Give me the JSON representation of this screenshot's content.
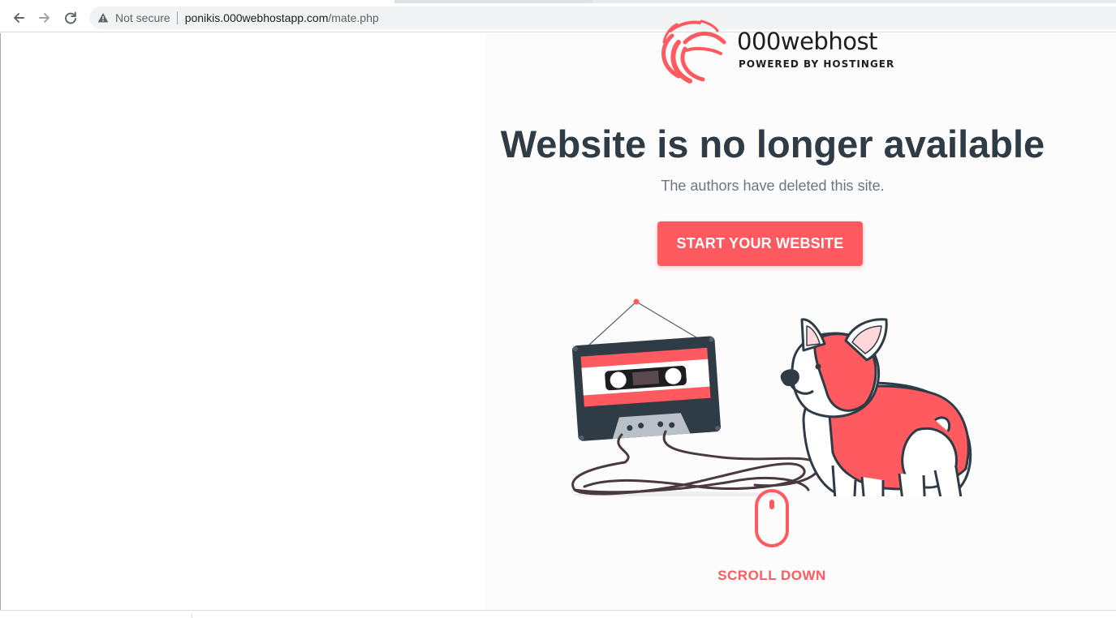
{
  "browser": {
    "back_icon": "arrow-left-icon",
    "forward_icon": "arrow-right-icon",
    "reload_icon": "reload-icon",
    "security_icon": "warning-triangle-icon",
    "security_label": "Not secure",
    "url_host": "ponikis.000webhostapp.com",
    "url_path": "/mate.php"
  },
  "page": {
    "logo": {
      "wordmark": "000webhost",
      "tagline": "POWERED BY HOSTINGER"
    },
    "headline": "Website is no longer available",
    "subline": "The authors have deleted this site.",
    "cta_label": "START YOUR WEBSITE",
    "scroll_label": "SCROLL DOWN",
    "illustration_icon": "cassette-and-corgi-illustration",
    "scroll_icon": "mouse-icon"
  },
  "colors": {
    "accent": "#ff5a5f",
    "headline": "#2f3b45",
    "muted_text": "#6c7680"
  }
}
